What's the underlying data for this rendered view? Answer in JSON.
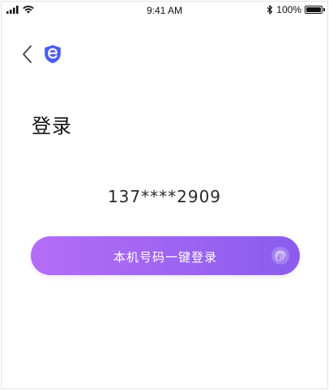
{
  "status_bar": {
    "time": "9:41 AM",
    "battery_text": "100%",
    "battery_level": 1.0,
    "icons": [
      "signal-icon",
      "wifi-icon",
      "bluetooth-icon",
      "battery-icon"
    ]
  },
  "nav": {
    "back_icon": "chevron-left-icon",
    "logo_icon": "shield-e-logo-icon",
    "logo_color": "#4a5cf0"
  },
  "page": {
    "title": "登录",
    "phone_number": "137****2909"
  },
  "login_button": {
    "label": "本机号码一键登录",
    "gradient_start": "#b46df6",
    "gradient_end": "#8a5cee",
    "icon": "fingerprint-icon"
  }
}
